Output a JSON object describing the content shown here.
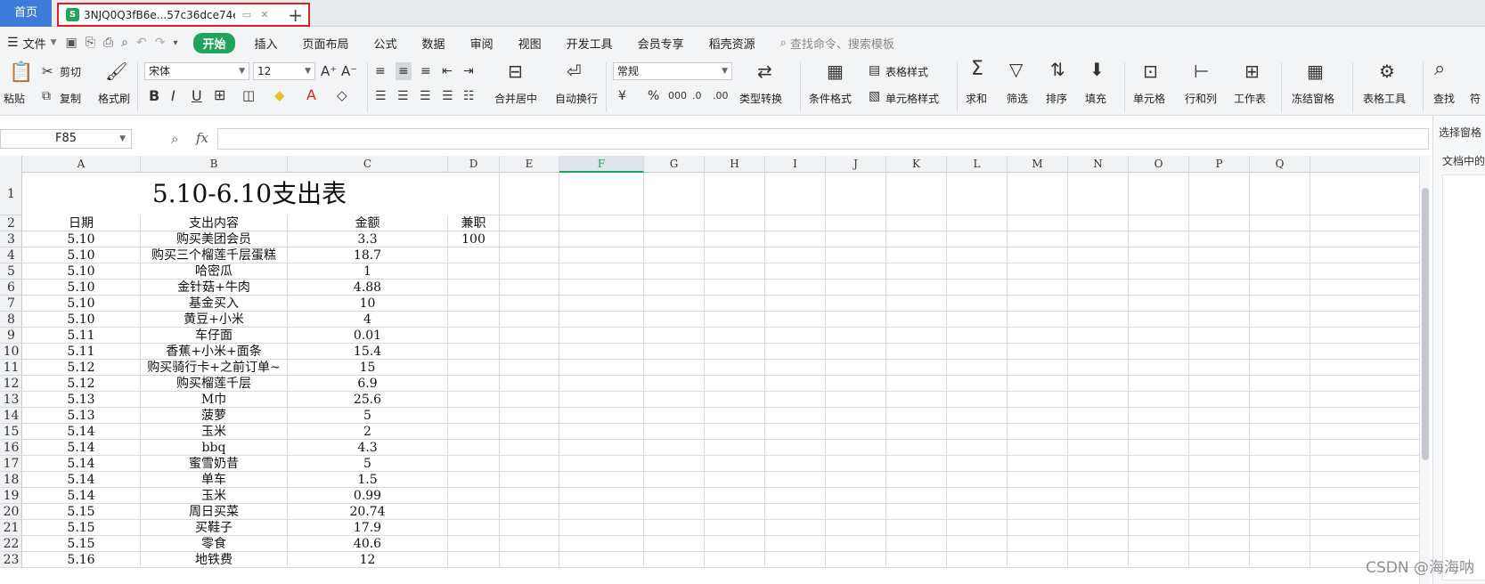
{
  "tabs": {
    "home_label": "首页",
    "doc_icon": "S",
    "doc_title": "3NJQ0Q3fB6e...57c36dce74e",
    "new_tab": "+"
  },
  "menu": {
    "file_label": "文件",
    "items": [
      "开始",
      "插入",
      "页面布局",
      "公式",
      "数据",
      "审阅",
      "视图",
      "开发工具",
      "会员专享",
      "稻壳资源"
    ],
    "active_item": "开始",
    "search_placeholder": "查找命令、搜索模板"
  },
  "ribbon": {
    "paste": "粘贴",
    "cut": "剪切",
    "copy": "复制",
    "format_painter": "格式刷",
    "font_name": "宋体",
    "font_size": "12",
    "merge_center": "合并居中",
    "wrap_text": "自动换行",
    "number_format": "常规",
    "type_convert": "类型转换",
    "conditional_format": "条件格式",
    "table_style": "表格样式",
    "cell_style": "单元格样式",
    "sum": "求和",
    "filter": "筛选",
    "sort": "排序",
    "fill": "填充",
    "cell": "单元格",
    "row_col": "行和列",
    "worksheet": "工作表",
    "freeze": "冻结窗格",
    "table_tools": "表格工具",
    "find": "查找",
    "symbol": "符"
  },
  "formula_bar": {
    "name_box": "F85",
    "fx": "fx",
    "value": ""
  },
  "right_pane": {
    "title": "选择窗格",
    "subtitle": "文档中的"
  },
  "sheet": {
    "columns": [
      "A",
      "B",
      "C",
      "D",
      "E",
      "F",
      "G",
      "H",
      "I",
      "J",
      "K",
      "L",
      "M",
      "N",
      "O",
      "P",
      "Q"
    ],
    "selected_column": "F",
    "title": "5.10-6.10支出表",
    "rows": [
      {
        "n": "1",
        "cells": [
          "",
          "",
          "",
          ""
        ]
      },
      {
        "n": "2",
        "cells": [
          "日期",
          "支出内容",
          "金额",
          "兼职"
        ]
      },
      {
        "n": "3",
        "cells": [
          "5.10",
          "购买美团会员",
          "3.3",
          "100"
        ]
      },
      {
        "n": "4",
        "cells": [
          "5.10",
          "购买三个榴莲千层蛋糕",
          "18.7",
          ""
        ]
      },
      {
        "n": "5",
        "cells": [
          "5.10",
          "哈密瓜",
          "1",
          ""
        ]
      },
      {
        "n": "6",
        "cells": [
          "5.10",
          "金针菇+牛肉",
          "4.88",
          ""
        ]
      },
      {
        "n": "7",
        "cells": [
          "5.10",
          "基金买入",
          "10",
          ""
        ]
      },
      {
        "n": "8",
        "cells": [
          "5.10",
          "黄豆+小米",
          "4",
          ""
        ]
      },
      {
        "n": "9",
        "cells": [
          "5.11",
          "车仔面",
          "0.01",
          ""
        ]
      },
      {
        "n": "10",
        "cells": [
          "5.11",
          "香蕉+小米+面条",
          "15.4",
          ""
        ]
      },
      {
        "n": "11",
        "cells": [
          "5.12",
          "购买骑行卡+之前订单~",
          "15",
          ""
        ]
      },
      {
        "n": "12",
        "cells": [
          "5.12",
          "购买榴莲千层",
          "6.9",
          ""
        ]
      },
      {
        "n": "13",
        "cells": [
          "5.13",
          "M巾",
          "25.6",
          ""
        ]
      },
      {
        "n": "14",
        "cells": [
          "5.13",
          "菠萝",
          "5",
          ""
        ]
      },
      {
        "n": "15",
        "cells": [
          "5.14",
          "玉米",
          "2",
          ""
        ]
      },
      {
        "n": "16",
        "cells": [
          "5.14",
          "bbq",
          "4.3",
          ""
        ]
      },
      {
        "n": "17",
        "cells": [
          "5.14",
          "蜜雪奶昔",
          "5",
          ""
        ]
      },
      {
        "n": "18",
        "cells": [
          "5.14",
          "单车",
          "1.5",
          ""
        ]
      },
      {
        "n": "19",
        "cells": [
          "5.14",
          "玉米",
          "0.99",
          ""
        ]
      },
      {
        "n": "20",
        "cells": [
          "5.15",
          "周日买菜",
          "20.74",
          ""
        ]
      },
      {
        "n": "21",
        "cells": [
          "5.15",
          "买鞋子",
          "17.9",
          ""
        ]
      },
      {
        "n": "22",
        "cells": [
          "5.15",
          "零食",
          "40.6",
          ""
        ]
      },
      {
        "n": "23",
        "cells": [
          "5.16",
          "地铁费",
          "12",
          ""
        ]
      }
    ]
  },
  "watermark": "CSDN @海海呐"
}
